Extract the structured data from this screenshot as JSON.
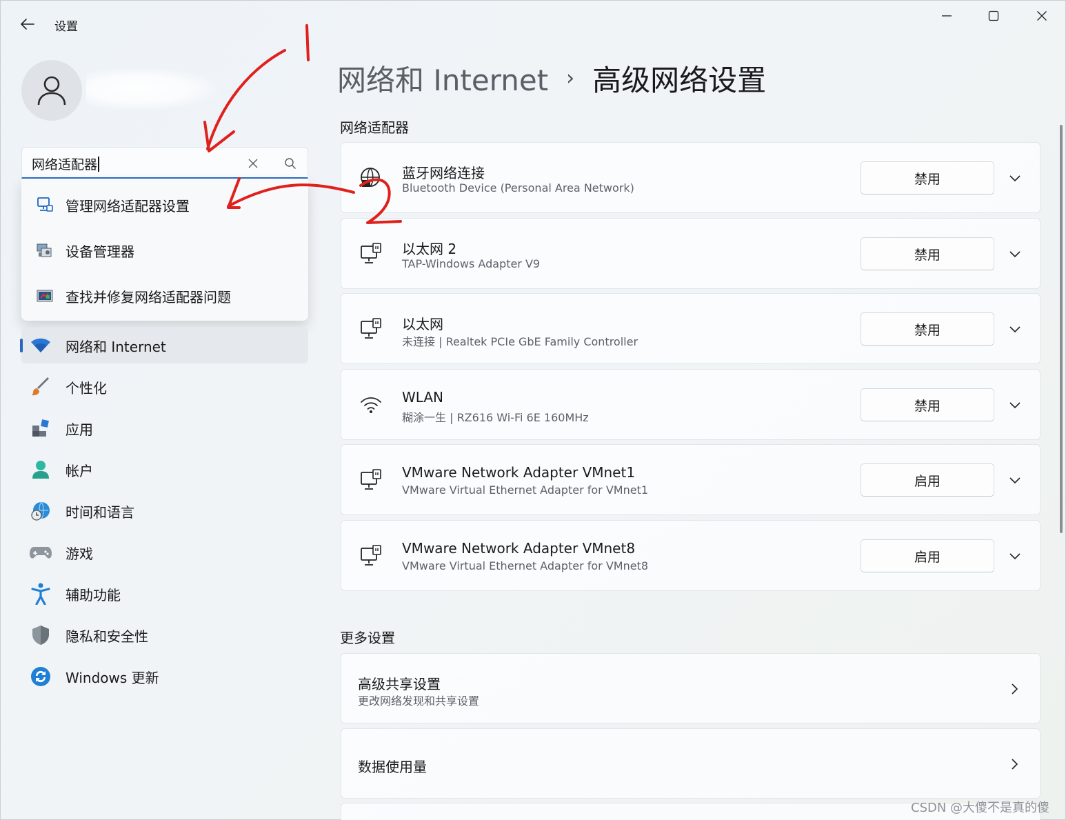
{
  "app": {
    "title": "设置"
  },
  "search": {
    "value": "网络适配器"
  },
  "suggestions": [
    {
      "label": "管理网络适配器设置",
      "icon": "network-adapter-settings-icon"
    },
    {
      "label": "设备管理器",
      "icon": "device-manager-icon"
    },
    {
      "label": "查找并修复网络适配器问题",
      "icon": "troubleshoot-icon"
    }
  ],
  "nav": [
    {
      "label": "网络和 Internet",
      "icon": "wifi-icon",
      "active": true
    },
    {
      "label": "个性化",
      "icon": "brush-icon"
    },
    {
      "label": "应用",
      "icon": "apps-icon"
    },
    {
      "label": "帐户",
      "icon": "account-icon"
    },
    {
      "label": "时间和语言",
      "icon": "globe-clock-icon"
    },
    {
      "label": "游戏",
      "icon": "gamepad-icon"
    },
    {
      "label": "辅助功能",
      "icon": "accessibility-icon"
    },
    {
      "label": "隐私和安全性",
      "icon": "shield-icon"
    },
    {
      "label": "Windows 更新",
      "icon": "update-icon"
    }
  ],
  "breadcrumb": {
    "parent": "网络和 Internet",
    "separator": "›",
    "current": "高级网络设置"
  },
  "sections": {
    "adapters": "网络适配器",
    "more": "更多设置"
  },
  "adapters": [
    {
      "name": "蓝牙网络连接",
      "desc": "Bluetooth Device (Personal Area Network)",
      "button": "禁用",
      "icon": "bluetooth-network-icon"
    },
    {
      "name": "以太网 2",
      "desc": "TAP-Windows Adapter V9",
      "button": "禁用",
      "icon": "ethernet-icon"
    },
    {
      "name": "以太网",
      "desc": "未连接 | Realtek PCIe GbE Family Controller",
      "button": "禁用",
      "icon": "ethernet-icon"
    },
    {
      "name": "WLAN",
      "desc": "糊涂一生 | RZ616 Wi-Fi 6E 160MHz",
      "button": "禁用",
      "icon": "wifi-icon"
    },
    {
      "name": "VMware Network Adapter VMnet1",
      "desc": "VMware Virtual Ethernet Adapter for VMnet1",
      "button": "启用",
      "icon": "ethernet-icon"
    },
    {
      "name": "VMware Network Adapter VMnet8",
      "desc": "VMware Virtual Ethernet Adapter for VMnet8",
      "button": "启用",
      "icon": "ethernet-icon"
    }
  ],
  "more_settings": [
    {
      "title": "高级共享设置",
      "sub": "更改网络发现和共享设置"
    },
    {
      "title": "数据使用量",
      "sub": ""
    }
  ],
  "annotations": {
    "step1": "1",
    "step2": "2",
    "color": "#e0201c"
  },
  "watermark": "CSDN @大傻不是真的傻"
}
